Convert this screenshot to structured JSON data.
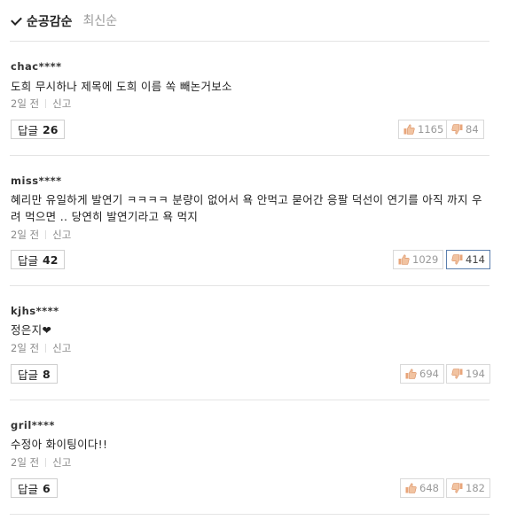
{
  "sort": {
    "active_label": "순공감순",
    "other_label": "최신순"
  },
  "comments": [
    {
      "user": "chac****",
      "text": "도희 무시하나 제목에 도희 이름 쏙 빼논거보소",
      "time": "2일 전",
      "report_label": "신고",
      "reply_label": "답글",
      "reply_count": "26",
      "likes": "1165",
      "dislikes": "84"
    },
    {
      "user": "miss****",
      "text": "혜리만 유일하게 발연기 ㅋㅋㅋㅋ 분량이 없어서 욕 안먹고 묻어간 응팔 덕선이 연기를 아직 까지 우려 먹으면 .. 당연히 발연기라고 욕 먹지",
      "time": "2일 전",
      "report_label": "신고",
      "reply_label": "답글",
      "reply_count": "42",
      "likes": "1029",
      "dislikes": "414"
    },
    {
      "user": "kjhs****",
      "text": "정은지❤",
      "time": "2일 전",
      "report_label": "신고",
      "reply_label": "답글",
      "reply_count": "8",
      "likes": "694",
      "dislikes": "194"
    },
    {
      "user": "gril****",
      "text": "수정아 화이팅이다!!",
      "time": "2일 전",
      "report_label": "신고",
      "reply_label": "답글",
      "reply_count": "6",
      "likes": "648",
      "dislikes": "182"
    }
  ],
  "icons": {
    "like": "thumbs-up-icon",
    "dislike": "thumbs-down-icon",
    "sort_check": "check-icon"
  },
  "colors": {
    "like_icon": "#e8a57a",
    "dislike_icon": "#e8a57a",
    "active_border": "#5b7fae",
    "divider": "#e4e4e4",
    "meta_text": "#8a8a8a"
  }
}
